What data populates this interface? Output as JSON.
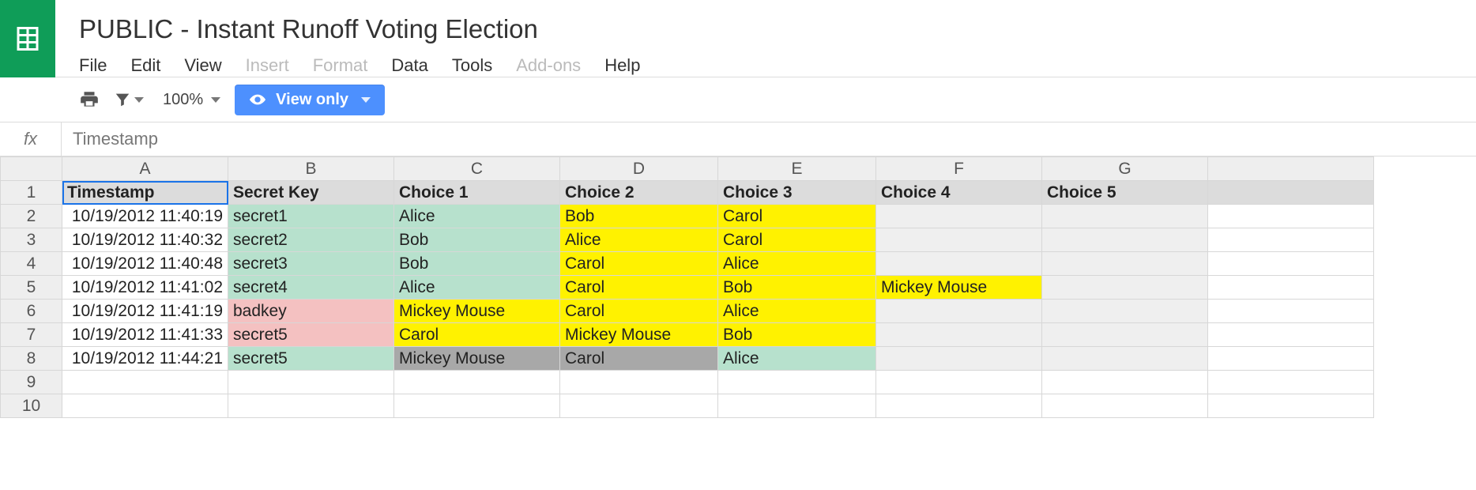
{
  "doc_title": "PUBLIC - Instant Runoff Voting Election",
  "menus": {
    "file": "File",
    "edit": "Edit",
    "view": "View",
    "insert": "Insert",
    "format": "Format",
    "data": "Data",
    "tools": "Tools",
    "addons": "Add-ons",
    "help": "Help"
  },
  "toolbar": {
    "zoom": "100%",
    "mode_label": "View only"
  },
  "formula": {
    "fx": "fx",
    "value": "Timestamp"
  },
  "columns": [
    "A",
    "B",
    "C",
    "D",
    "E",
    "F",
    "G"
  ],
  "row_numbers": [
    "1",
    "2",
    "3",
    "4",
    "5",
    "6",
    "7",
    "8",
    "9",
    "10"
  ],
  "header_row": [
    "Timestamp",
    "Secret Key",
    "Choice 1",
    "Choice 2",
    "Choice 3",
    "Choice 4",
    "Choice 5"
  ],
  "rows": [
    {
      "ts": "10/19/2012 11:40:19",
      "key": "secret1",
      "c1": "Alice",
      "c2": "Bob",
      "c3": "Carol",
      "c4": "",
      "c5": "",
      "cls": {
        "key": "bg-green",
        "c1": "bg-green",
        "c2": "bg-yellow",
        "c3": "bg-yellow",
        "c4": "bg-lgray",
        "c5": "bg-lgray"
      }
    },
    {
      "ts": "10/19/2012 11:40:32",
      "key": "secret2",
      "c1": "Bob",
      "c2": "Alice",
      "c3": "Carol",
      "c4": "",
      "c5": "",
      "cls": {
        "key": "bg-green",
        "c1": "bg-green",
        "c2": "bg-yellow",
        "c3": "bg-yellow",
        "c4": "bg-lgray",
        "c5": "bg-lgray"
      }
    },
    {
      "ts": "10/19/2012 11:40:48",
      "key": "secret3",
      "c1": "Bob",
      "c2": "Carol",
      "c3": "Alice",
      "c4": "",
      "c5": "",
      "cls": {
        "key": "bg-green",
        "c1": "bg-green",
        "c2": "bg-yellow",
        "c3": "bg-yellow",
        "c4": "bg-lgray",
        "c5": "bg-lgray"
      }
    },
    {
      "ts": "10/19/2012 11:41:02",
      "key": "secret4",
      "c1": "Alice",
      "c2": "Carol",
      "c3": "Bob",
      "c4": "Mickey Mouse",
      "c5": "",
      "cls": {
        "key": "bg-green",
        "c1": "bg-green",
        "c2": "bg-yellow",
        "c3": "bg-yellow",
        "c4": "bg-yellow",
        "c5": "bg-lgray"
      }
    },
    {
      "ts": "10/19/2012 11:41:19",
      "key": "badkey",
      "c1": "Mickey Mouse",
      "c2": "Carol",
      "c3": "Alice",
      "c4": "",
      "c5": "",
      "cls": {
        "key": "bg-pink",
        "c1": "bg-yellow",
        "c2": "bg-yellow",
        "c3": "bg-yellow",
        "c4": "bg-lgray",
        "c5": "bg-lgray"
      }
    },
    {
      "ts": "10/19/2012 11:41:33",
      "key": "secret5",
      "c1": "Carol",
      "c2": "Mickey Mouse",
      "c3": "Bob",
      "c4": "",
      "c5": "",
      "cls": {
        "key": "bg-pink",
        "c1": "bg-yellow",
        "c2": "bg-yellow",
        "c3": "bg-yellow",
        "c4": "bg-lgray",
        "c5": "bg-lgray"
      }
    },
    {
      "ts": "10/19/2012 11:44:21",
      "key": "secret5",
      "c1": "Mickey Mouse",
      "c2": "Carol",
      "c3": "Alice",
      "c4": "",
      "c5": "",
      "cls": {
        "key": "bg-green",
        "c1": "bg-gray",
        "c2": "bg-gray",
        "c3": "bg-green",
        "c4": "bg-lgray",
        "c5": "bg-lgray"
      }
    }
  ]
}
